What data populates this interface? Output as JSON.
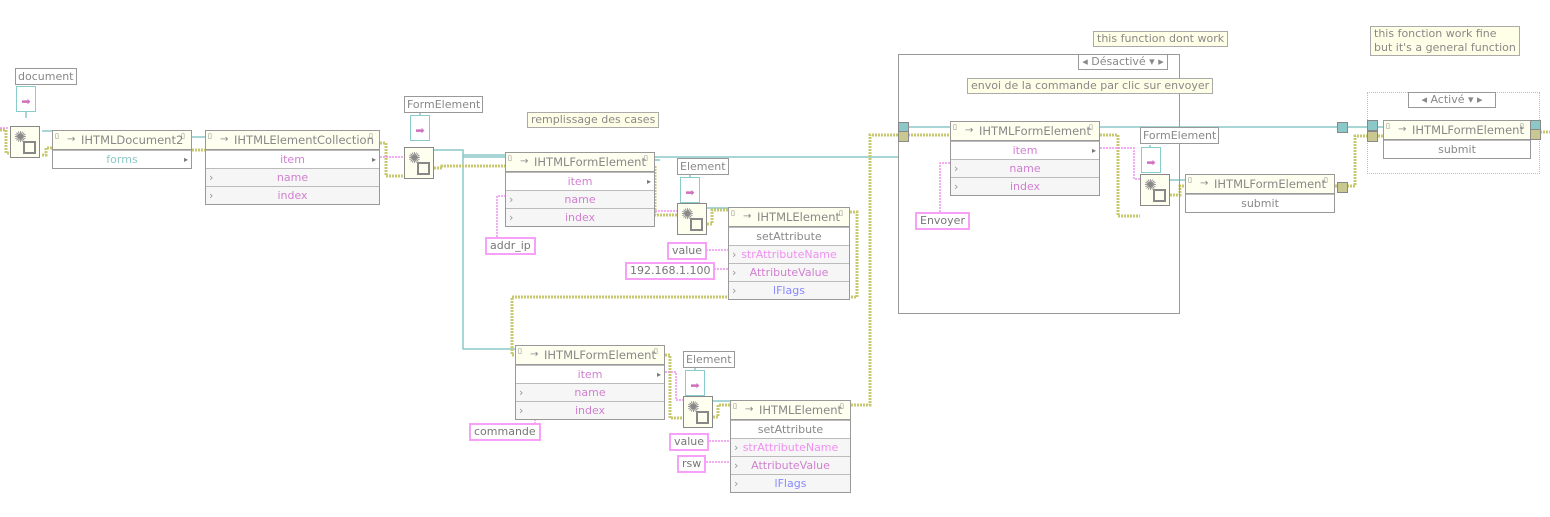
{
  "comments": {
    "fill": "remplissage des cases",
    "not_work": "this function dont work",
    "send": "envoi de la commande par clic sur envoyer",
    "work_fine_1": "this fonction work fine",
    "work_fine_2": "but it's a general function"
  },
  "class_labels": {
    "document": "document",
    "form_element_1": "FormElement",
    "element_1": "Element",
    "element_2": "Element",
    "form_element_2": "FormElement"
  },
  "case_structures": {
    "disabled_selector": "Désactivé",
    "enabled_selector": "Activé"
  },
  "constants": {
    "addr_ip": "addr_ip",
    "value_1": "value",
    "ip_value": "192.168.1.100",
    "commande": "commande",
    "value_2": "value",
    "rsw": "rsw",
    "envoyer": "Envoyer"
  },
  "nodes": {
    "doc2": {
      "class": "IHTMLDocument2",
      "rows": [
        "forms"
      ]
    },
    "collection": {
      "class": "IHTMLElementCollection",
      "rows": [
        "item",
        "name",
        "index"
      ]
    },
    "form1": {
      "class": "IHTMLFormElement",
      "rows": [
        "item",
        "name",
        "index"
      ]
    },
    "elem1": {
      "class": "IHTMLElement",
      "rows": [
        "setAttribute",
        "strAttributeName",
        "AttributeValue",
        "lFlags"
      ]
    },
    "form2": {
      "class": "IHTMLFormElement",
      "rows": [
        "item",
        "name",
        "index"
      ]
    },
    "elem2": {
      "class": "IHTMLElement",
      "rows": [
        "setAttribute",
        "strAttributeName",
        "AttributeValue",
        "lFlags"
      ]
    },
    "form3": {
      "class": "IHTMLFormElement",
      "rows": [
        "item",
        "name",
        "index"
      ]
    },
    "submit1": {
      "class": "IHTMLFormElement",
      "rows": [
        "submit"
      ]
    },
    "submit2": {
      "class": "IHTMLFormElement",
      "rows": [
        "submit"
      ]
    }
  },
  "colors": {
    "refnum_wire": "#8cc8c8",
    "error_wire": "#c8c870",
    "string_wire": "#f090f0",
    "string_text": "#d080d0",
    "numeric_text": "#8888ff"
  }
}
